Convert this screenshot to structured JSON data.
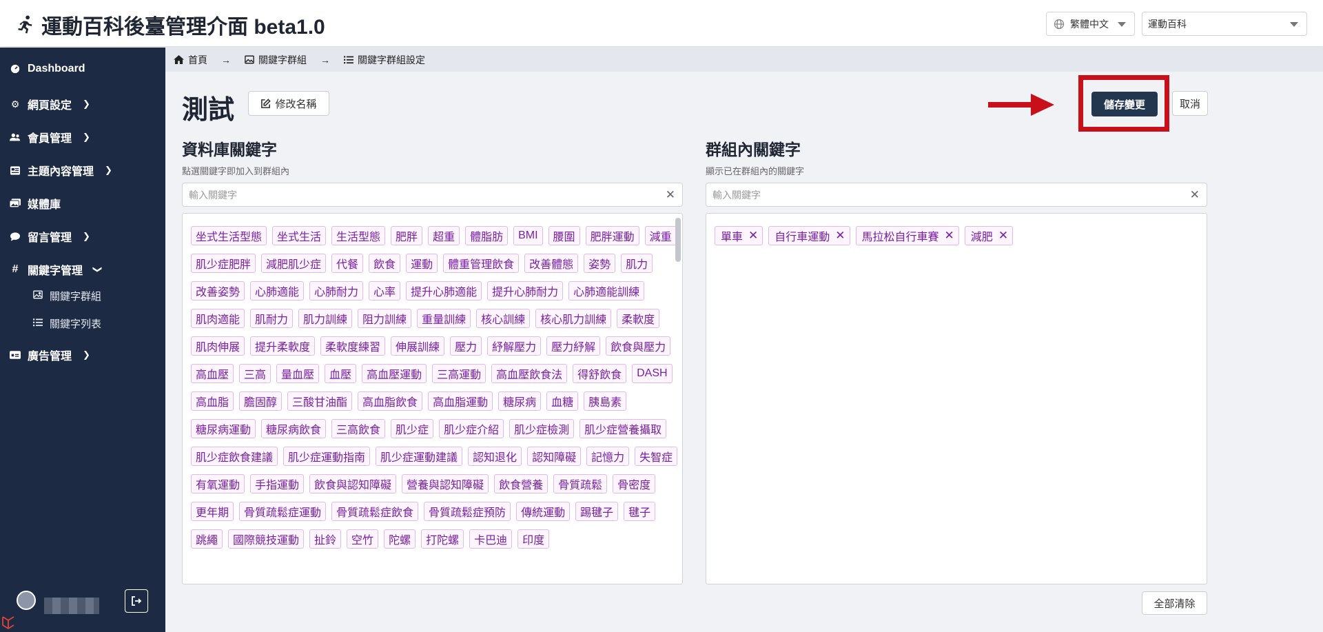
{
  "app": {
    "title": "運動百科後臺管理介面 beta1.0"
  },
  "header": {
    "language": "繁體中文",
    "site": "運動百科"
  },
  "sidebar": {
    "items": [
      {
        "label": "Dashboard",
        "icon": "dashboard-icon"
      },
      {
        "label": "網頁設定",
        "icon": "gear-icon"
      },
      {
        "label": "會員管理",
        "icon": "users-icon"
      },
      {
        "label": "主題內容管理",
        "icon": "content-icon"
      },
      {
        "label": "媒體庫",
        "icon": "images-icon"
      },
      {
        "label": "留言管理",
        "icon": "comment-icon"
      },
      {
        "label": "關鍵字管理",
        "icon": "hash-icon"
      },
      {
        "label": "廣告管理",
        "icon": "ad-icon"
      }
    ],
    "subitems": [
      {
        "label": "關鍵字群組",
        "icon": "image-icon"
      },
      {
        "label": "關鍵字列表",
        "icon": "list-icon"
      }
    ]
  },
  "breadcrumb": [
    "首頁",
    "關鍵字群組",
    "關鍵字群組設定"
  ],
  "page": {
    "title": "測試",
    "rename_label": "修改名稱",
    "save_label": "儲存變更",
    "cancel_label": "取消",
    "clear_all_label": "全部清除"
  },
  "database": {
    "title": "資料庫關鍵字",
    "hint": "點選關鍵字即加入到群組內",
    "placeholder": "輸入關鍵字",
    "keywords": [
      "坐式生活型態",
      "坐式生活",
      "生活型態",
      "肥胖",
      "超重",
      "體脂肪",
      "BMI",
      "腰圍",
      "肥胖運動",
      "減重",
      "肌少症肥胖",
      "減肥肌少症",
      "代餐",
      "飲食",
      "運動",
      "體重管理飲食",
      "改善體態",
      "姿勢",
      "肌力",
      "改善姿勢",
      "心肺適能",
      "心肺耐力",
      "心率",
      "提升心肺適能",
      "提升心肺耐力",
      "心肺適能訓練",
      "肌肉適能",
      "肌耐力",
      "肌力訓練",
      "阻力訓練",
      "重量訓練",
      "核心訓練",
      "核心肌力訓練",
      "柔軟度",
      "肌肉伸展",
      "提升柔軟度",
      "柔軟度練習",
      "伸展訓練",
      "壓力",
      "紓解壓力",
      "壓力紓解",
      "飲食與壓力",
      "高血壓",
      "三高",
      "量血壓",
      "血壓",
      "高血壓運動",
      "三高運動",
      "高血壓飲食法",
      "得舒飲食",
      "DASH",
      "高血脂",
      "膽固醇",
      "三酸甘油酯",
      "高血脂飲食",
      "高血脂運動",
      "糖尿病",
      "血糖",
      "胰島素",
      "糖尿病運動",
      "糖尿病飲食",
      "三高飲食",
      "肌少症",
      "肌少症介紹",
      "肌少症檢測",
      "肌少症營養攝取",
      "肌少症飲食建議",
      "肌少症運動指南",
      "肌少症運動建議",
      "認知退化",
      "認知障礙",
      "記憶力",
      "失智症",
      "有氧運動",
      "手指運動",
      "飲食與認知障礙",
      "營養與認知障礙",
      "飲食營養",
      "骨質疏鬆",
      "骨密度",
      "更年期",
      "骨質疏鬆症運動",
      "骨質疏鬆症飲食",
      "骨質疏鬆症預防",
      "傳統運動",
      "踢毽子",
      "毽子",
      "跳繩",
      "國際競技運動",
      "扯鈴",
      "空竹",
      "陀螺",
      "打陀螺",
      "卡巴迪",
      "印度"
    ]
  },
  "group": {
    "title": "群組內關鍵字",
    "hint": "顯示已在群組內的關鍵字",
    "placeholder": "輸入關鍵字",
    "keywords": [
      "單車",
      "自行車運動",
      "馬拉松自行車賽",
      "減肥"
    ]
  }
}
